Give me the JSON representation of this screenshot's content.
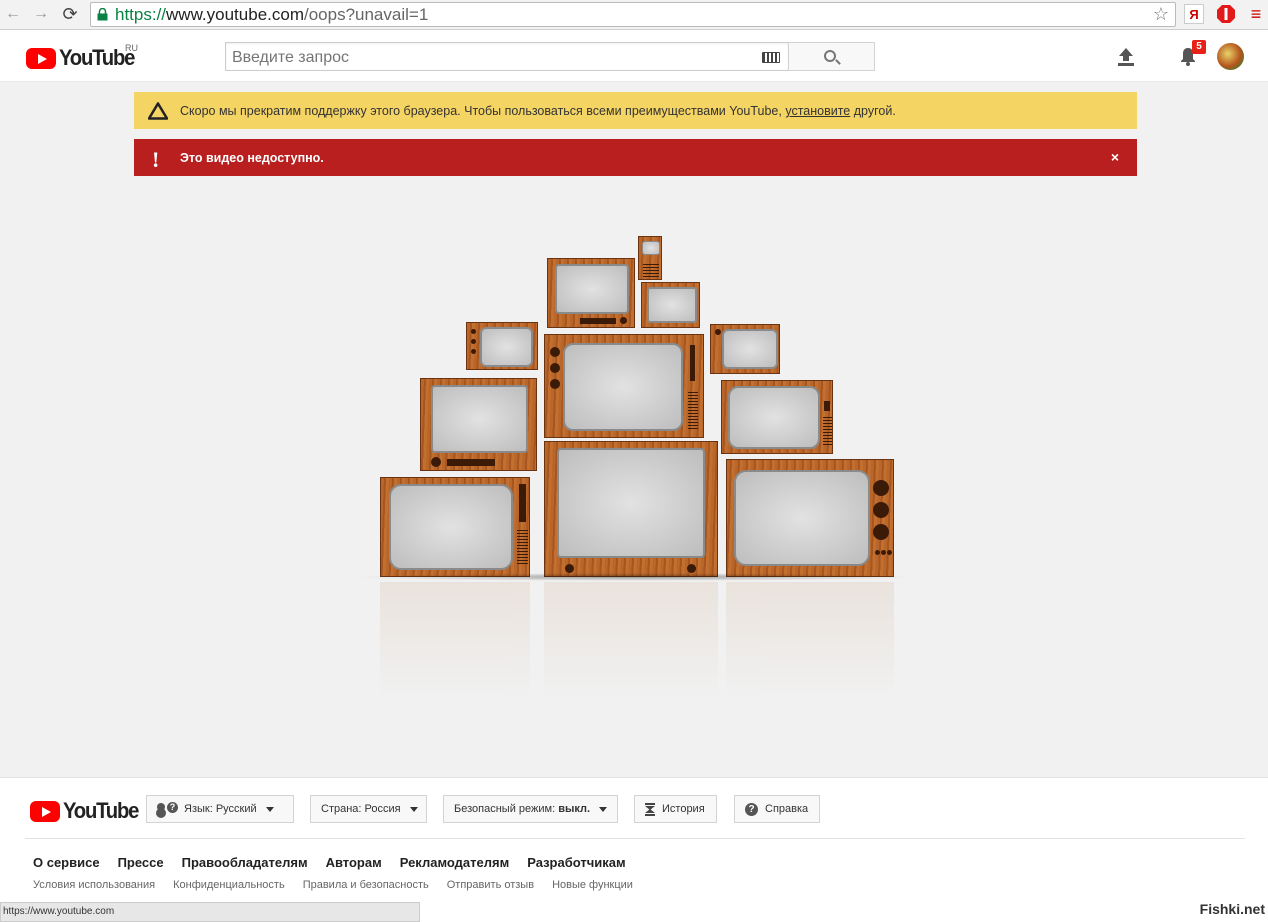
{
  "browser": {
    "url_scheme": "https://",
    "url_host": "www.youtube.com",
    "url_path": "/oops?unavail=1",
    "back_glyph": "←",
    "forward_glyph": "→",
    "reload_glyph": "⟳",
    "star_glyph": "☆",
    "ext_yandex": "Я",
    "ext_menu": "≡",
    "status_url": "https://www.youtube.com"
  },
  "masthead": {
    "logo_text": "YouTube",
    "region": "RU",
    "search_placeholder": "Введите запрос",
    "notification_count": "5"
  },
  "alerts": {
    "warning_text": "Скоро мы прекратим поддержку этого браузера. Чтобы пользоваться всеми преимуществами YouTube,",
    "warning_link": "установите",
    "warning_tail": "другой.",
    "error_text": "Это видео недоступно.",
    "error_icon": "!",
    "close_glyph": "×"
  },
  "footer": {
    "logo_text": "YouTube",
    "language_label": "Язык:",
    "language_value": "Русский",
    "country_label": "Страна:",
    "country_value": "Россия",
    "safety_label": "Безопасный режим:",
    "safety_value": "выкл.",
    "history_label": "История",
    "help_label": "Справка",
    "help_icon": "?",
    "primary_links": [
      "О сервисе",
      "Прессе",
      "Правообладателям",
      "Авторам",
      "Рекламодателям",
      "Разработчикам"
    ],
    "secondary_links": [
      "Условия использования",
      "Конфиденциальность",
      "Правила и безопасность",
      "Отправить отзыв",
      "Новые функции"
    ]
  },
  "watermark": "Fishki.net",
  "colors": {
    "yt_red": "#ff0000",
    "warning_bg": "#f4d463",
    "error_bg": "#b91f1f",
    "badge": "#e62117"
  }
}
